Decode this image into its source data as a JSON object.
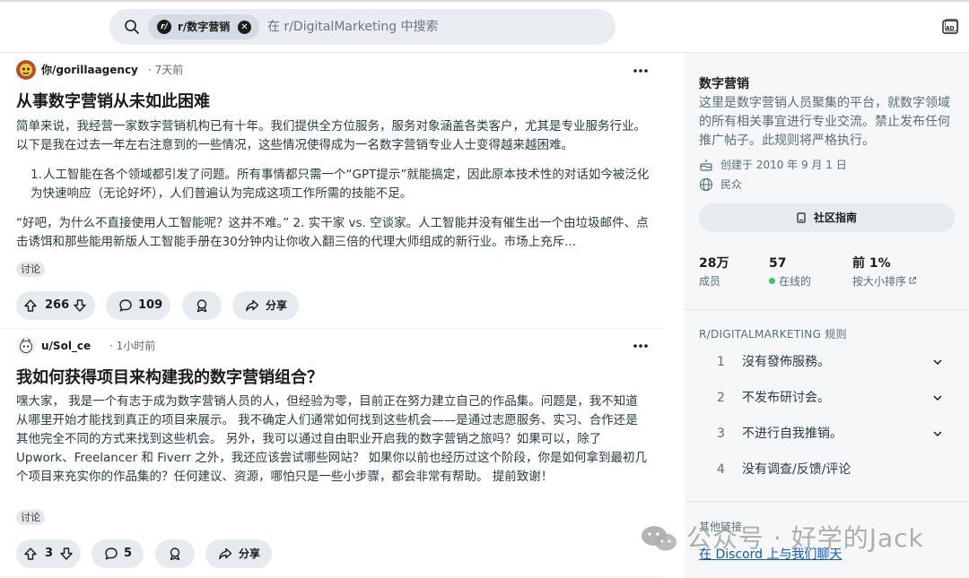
{
  "header": {
    "subreddit_chip": "r/数字营销",
    "search_placeholder": "在 r/DigitalMarketing 中搜索"
  },
  "posts": [
    {
      "author": "你/gorillaagency",
      "time": "· 7天前",
      "title": "从事数字营销从未如此困难",
      "paragraphs": [
        "简单来说，我经营一家数字营销机构已有十年。我们提供全方位服务，服务对象涵盖各类客户，尤其是专业服务行业。以下是我在过去一年左右注意到的一些情况，这些情况使得成为一名数字营销专业人士变得越来越困难。"
      ],
      "list_item_number": "1.",
      "list_item": "人工智能在各个领域都引发了问题。所有事情都只需一个“GPT提示”就能搞定，因此原本技术性的对话如今被泛化为快速响应（无论好坏），人们普遍认为完成这项工作所需的技能不足。",
      "paragraph_after": "“好吧，为什么不直接使用人工智能呢？这并不难。” 2. 实干家 vs. 空谈家。人工智能并没有催生出一个由垃圾邮件、点击诱饵和那些能用新版人工智能手册在30分钟内让你收入翻三倍的代理大师组成的新行业。市场上充斥...",
      "flair": "讨论",
      "votes": "266",
      "comments": "109",
      "share": "分享"
    },
    {
      "author": "u/Sol_ce",
      "time": "· 1小时前",
      "title": "我如何获得项目来构建我的数字营销组合？",
      "paragraphs": [
        "嘿大家， 我是一个有志于成为数字营销人员的人，但经验为零，目前正在努力建立自己的作品集。问题是，我不知道从哪里开始才能找到真正的项目来展示。 我不确定人们通常如何找到这些机会——是通过志愿服务、实习、合作还是其他完全不同的方式来找到这些机会。 另外，我可以通过自由职业开启我的数字营销之旅吗？如果可以，除了 Upwork、Freelancer 和 Fiverr 之外，我还应该尝试哪些网站？ 如果你以前也经历过这个阶段，你是如何拿到最初几个项目来充实你的作品集的？任何建议、资源，哪怕只是一些小步骤，都会非常有帮助。 提前致谢！"
      ],
      "flair": "讨论",
      "votes": "3",
      "comments": "5",
      "share": "分享"
    }
  ],
  "sidebar": {
    "title": "数字营销",
    "description": "这里是数字营销人员聚集的平台，就数字领域的所有相关事宜进行专业交流。禁止发布任何推广帖子。此规则将严格执行。",
    "created": "创建于 2010 年 9 月 1 日",
    "visibility": "民众",
    "guide_button": "社区指南",
    "stats": [
      {
        "value": "28万",
        "label": "成员"
      },
      {
        "value": "57",
        "label": "在线的"
      },
      {
        "value": "前 1%",
        "label": "按大小排序"
      }
    ],
    "rules_heading": "R/DIGITALMARKETING 规则",
    "rules": [
      {
        "num": "1",
        "text": "沒有發佈服務。"
      },
      {
        "num": "2",
        "text": "不发布研讨会。"
      },
      {
        "num": "3",
        "text": "不进行自我推销。"
      },
      {
        "num": "4",
        "text": "没有调查/反馈/评论"
      }
    ],
    "other_links_heading": "其他链接",
    "discord_link": "在 Discord 上与我们聊天"
  },
  "watermark": "公众号 · 好学的Jack"
}
